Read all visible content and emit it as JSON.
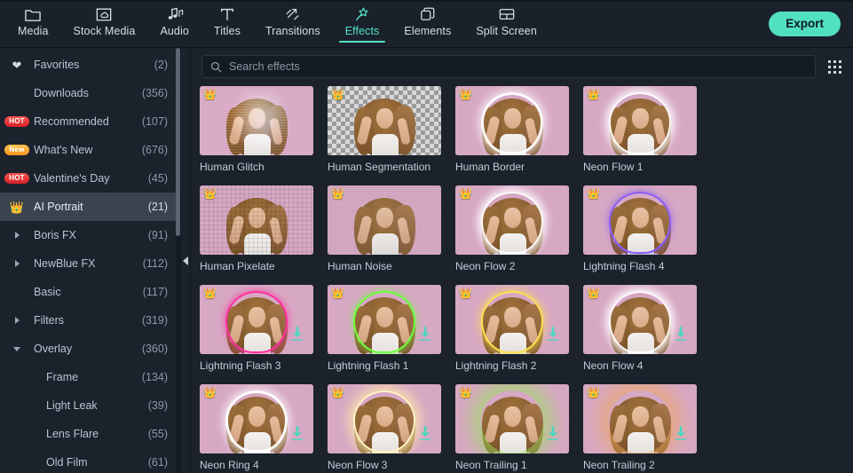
{
  "toolbar": {
    "tabs": [
      {
        "label": "Media",
        "icon": "folder-icon",
        "active": false
      },
      {
        "label": "Stock Media",
        "icon": "cloud-folder-icon",
        "active": false
      },
      {
        "label": "Audio",
        "icon": "music-note-icon",
        "active": false
      },
      {
        "label": "Titles",
        "icon": "text-t-icon",
        "active": false
      },
      {
        "label": "Transitions",
        "icon": "arrows-diagonal-icon",
        "active": false
      },
      {
        "label": "Effects",
        "icon": "magic-wand-star-icon",
        "active": true
      },
      {
        "label": "Elements",
        "icon": "layers-icon",
        "active": false
      },
      {
        "label": "Split Screen",
        "icon": "split-screen-icon",
        "active": false
      }
    ],
    "export_label": "Export",
    "accent_color": "#51e0c0"
  },
  "sidebar": {
    "items": [
      {
        "label": "Favorites",
        "count": "(2)",
        "icon": "heart-icon",
        "marker": "none",
        "selected": false,
        "sub": false
      },
      {
        "label": "Downloads",
        "count": "(356)",
        "icon": "none",
        "marker": "none",
        "selected": false,
        "sub": false
      },
      {
        "label": "Recommended",
        "count": "(107)",
        "icon": "none",
        "marker": "hot",
        "badge": "HOT",
        "selected": false,
        "sub": false
      },
      {
        "label": "What's New",
        "count": "(676)",
        "icon": "none",
        "marker": "new",
        "badge": "New",
        "selected": false,
        "sub": false
      },
      {
        "label": "Valentine's Day",
        "count": "(45)",
        "icon": "none",
        "marker": "hot",
        "badge": "HOT",
        "selected": false,
        "sub": false
      },
      {
        "label": "AI Portrait",
        "count": "(21)",
        "icon": "crown-icon",
        "marker": "none",
        "selected": true,
        "sub": false
      },
      {
        "label": "Boris FX",
        "count": "(91)",
        "icon": "none",
        "marker": "caret-right",
        "selected": false,
        "sub": false
      },
      {
        "label": "NewBlue FX",
        "count": "(112)",
        "icon": "none",
        "marker": "caret-right",
        "selected": false,
        "sub": false
      },
      {
        "label": "Basic",
        "count": "(117)",
        "icon": "none",
        "marker": "none",
        "selected": false,
        "sub": false
      },
      {
        "label": "Filters",
        "count": "(319)",
        "icon": "none",
        "marker": "caret-right",
        "selected": false,
        "sub": false
      },
      {
        "label": "Overlay",
        "count": "(360)",
        "icon": "none",
        "marker": "caret-down",
        "selected": false,
        "sub": false
      },
      {
        "label": "Frame",
        "count": "(134)",
        "icon": "none",
        "marker": "none",
        "selected": false,
        "sub": true
      },
      {
        "label": "Light Leak",
        "count": "(39)",
        "icon": "none",
        "marker": "none",
        "selected": false,
        "sub": true
      },
      {
        "label": "Lens Flare",
        "count": "(55)",
        "icon": "none",
        "marker": "none",
        "selected": false,
        "sub": true
      },
      {
        "label": "Old Film",
        "count": "(61)",
        "icon": "none",
        "marker": "none",
        "selected": false,
        "sub": true
      }
    ],
    "collapse_label": "Collapse panel"
  },
  "search": {
    "placeholder": "Search effects",
    "value": "",
    "icon": "search-icon",
    "view_toggle_icon": "grid-view-icon"
  },
  "effects_grid": {
    "items": [
      {
        "name": "Human Glitch",
        "premium": true,
        "downloadable": false,
        "style": "glitch",
        "bg": "pink"
      },
      {
        "name": "Human Segmentation",
        "premium": true,
        "downloadable": false,
        "style": "segmentation",
        "bg": "checker"
      },
      {
        "name": "Human Border",
        "premium": true,
        "downloadable": false,
        "style": "border-white",
        "bg": "pink"
      },
      {
        "name": "Neon Flow 1",
        "premium": true,
        "downloadable": false,
        "style": "glow-white",
        "bg": "pink"
      },
      {
        "name": "Human Pixelate",
        "premium": true,
        "downloadable": false,
        "style": "pixelate",
        "bg": "pink"
      },
      {
        "name": "Human Noise",
        "premium": true,
        "downloadable": false,
        "style": "noise",
        "bg": "pink"
      },
      {
        "name": "Neon Flow 2",
        "premium": true,
        "downloadable": false,
        "style": "glow-white",
        "bg": "pink"
      },
      {
        "name": "Lightning Flash 4",
        "premium": true,
        "downloadable": false,
        "style": "glow-purple",
        "bg": "pink"
      },
      {
        "name": "Lightning Flash 3",
        "premium": true,
        "downloadable": true,
        "style": "glow-pink",
        "bg": "pink"
      },
      {
        "name": "Lightning Flash 1",
        "premium": true,
        "downloadable": true,
        "style": "glow-green",
        "bg": "pink"
      },
      {
        "name": "Lightning Flash 2",
        "premium": true,
        "downloadable": true,
        "style": "glow-yellow",
        "bg": "pink"
      },
      {
        "name": "Neon Flow 4",
        "premium": true,
        "downloadable": true,
        "style": "glow-white",
        "bg": "pink"
      },
      {
        "name": "Neon Ring 4",
        "premium": true,
        "downloadable": true,
        "style": "ring-white",
        "bg": "pink"
      },
      {
        "name": "Neon Flow 3",
        "premium": true,
        "downloadable": true,
        "style": "glow-cream",
        "bg": "pink"
      },
      {
        "name": "Neon Trailing 1",
        "premium": true,
        "downloadable": true,
        "style": "soft-green",
        "bg": "pink"
      },
      {
        "name": "Neon Trailing 2",
        "premium": true,
        "downloadable": true,
        "style": "soft-orange",
        "bg": "pink"
      }
    ],
    "premium_icon": "crown-icon",
    "download_icon": "download-arrow-icon",
    "download_color": "#4ad6bd"
  }
}
